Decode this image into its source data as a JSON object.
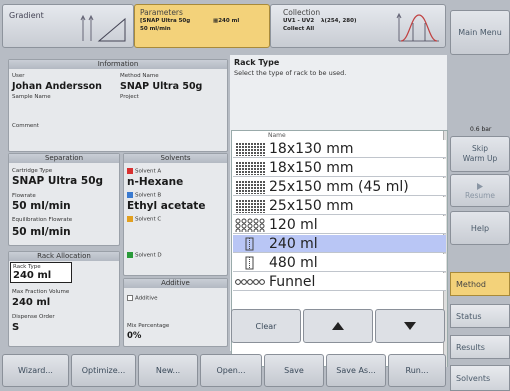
{
  "top": {
    "gradient_label": "Gradient",
    "parameters_title": "Parameters",
    "parameters_line1": "[SNAP Ultra 50g",
    "parameters_flow": "50 ml/min",
    "parameters_vol": "240 ml",
    "collection_title": "Collection",
    "collection_line1": "UV1 - UV2",
    "collection_line1b": "λ(254, 280)",
    "collection_line2": "Collect All"
  },
  "info": {
    "header": "Information",
    "user_label": "User",
    "user": "Johan Andersson",
    "method_label": "Method Name",
    "method": "SNAP Ultra 50g",
    "sample_label": "Sample Name",
    "project_label": "Project",
    "comment_label": "Comment"
  },
  "separation": {
    "header": "Separation",
    "cartridge_label": "Cartridge Type",
    "cartridge": "SNAP Ultra 50g",
    "flowrate_label": "Flowrate",
    "flowrate": "50 ml/min",
    "eq_label": "Equilibration Flowrate",
    "eq": "50 ml/min"
  },
  "solvents": {
    "header": "Solvents",
    "a_label": "Solvent A",
    "a": "n-Hexane",
    "b_label": "Solvent B",
    "b": "Ethyl acetate",
    "c_label": "Solvent C",
    "d_label": "Solvent D"
  },
  "rack": {
    "header": "Rack Allocation",
    "type_label": "Rack Type",
    "type": "240 ml",
    "maxvol_label": "Max Fraction Volume",
    "maxvol": "240 ml",
    "order_label": "Dispense Order",
    "order": "S"
  },
  "additive": {
    "header": "Additive",
    "label": "Additive",
    "pct_label": "Mix Percentage",
    "pct": "0%"
  },
  "racktype": {
    "title": "Rack Type",
    "subtitle": "Select the type of rack to be used.",
    "col_name": "Name",
    "items": [
      {
        "label": "18x130 mm"
      },
      {
        "label": "18x150 mm"
      },
      {
        "label": "25x150 mm (45 ml)"
      },
      {
        "label": "25x150 mm"
      },
      {
        "label": "120 ml"
      },
      {
        "label": "240 ml"
      },
      {
        "label": "480 ml"
      },
      {
        "label": "Funnel"
      }
    ],
    "selected_index": 5,
    "clear": "Clear"
  },
  "side": {
    "main_menu": "Main Menu",
    "pressure": "0.6 bar",
    "skip": "Skip\nWarm Up",
    "resume": "Resume",
    "help": "Help",
    "method": "Method",
    "status": "Status",
    "results": "Results",
    "solvents": "Solvents"
  },
  "bottom": {
    "wizard": "Wizard...",
    "optimize": "Optimize...",
    "new": "New...",
    "open": "Open...",
    "save": "Save",
    "saveas": "Save As...",
    "run": "Run..."
  },
  "colors": {
    "accent": "#f3d27a",
    "selected": "#b9c6f5",
    "solvent_a": "#d83030",
    "solvent_b": "#3a7ad0",
    "solvent_c": "#e2a020",
    "solvent_d": "#2a9a3a"
  }
}
